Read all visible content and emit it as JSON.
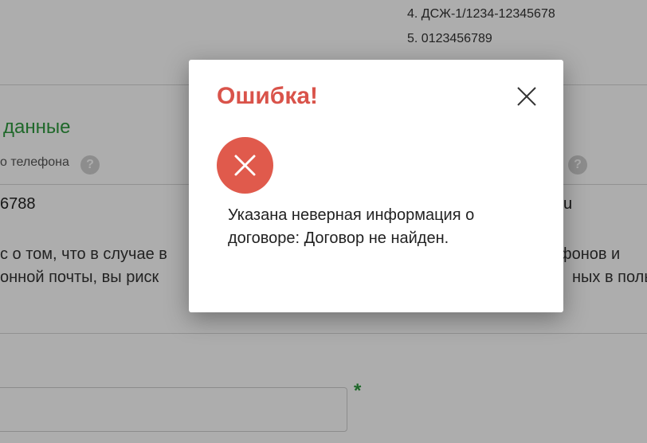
{
  "background": {
    "list_items": [
      "4. ДСЖ-1/1234-12345678",
      "5. 0123456789"
    ],
    "section_title": "данные",
    "phone_label": "о телефона",
    "help_icon": "?",
    "phone_value": "6788",
    "email_value_fragment": "u",
    "notice_line1_left": "с о том, что в случае в",
    "notice_line1_right": "ефонов и",
    "notice_line2_left": "онной почты, вы риск",
    "notice_line2_right": "ных в поль",
    "required_mark": "*"
  },
  "modal": {
    "title": "Ошибка!",
    "close_icon": "close-icon",
    "error_icon": "error-x-icon",
    "message": "Указана неверная информация о договоре: Договор не найден."
  },
  "colors": {
    "error": "#e05a4c",
    "title": "#d9534a",
    "accent_green": "#2e9a3e",
    "overlay": "rgba(0,0,0,0.32)"
  }
}
